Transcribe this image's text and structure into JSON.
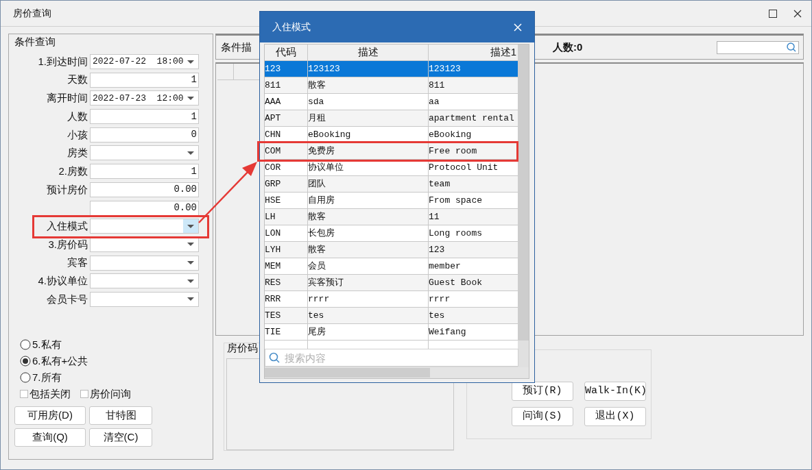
{
  "window": {
    "title": "房价查询"
  },
  "conditions": {
    "title": "条件查询",
    "fields": [
      {
        "label": "1.到达时间",
        "kind": "combo",
        "value": "2022-07-22  18:00",
        "active": false
      },
      {
        "label": "天数",
        "kind": "text",
        "value": "1"
      },
      {
        "label": "离开时间",
        "kind": "combo",
        "value": "2022-07-23  12:00",
        "active": false
      },
      {
        "label": "人数",
        "kind": "text",
        "value": "1"
      },
      {
        "label": "小孩",
        "kind": "text",
        "value": "0"
      },
      {
        "label": "房类",
        "kind": "combo",
        "active": false
      },
      {
        "label": "2.房数",
        "kind": "text",
        "value": "1"
      },
      {
        "label": "预计房价",
        "kind": "text",
        "value": "0.00"
      },
      {
        "kind": "text",
        "value": "0.00"
      },
      {
        "label": "入住模式",
        "kind": "combo",
        "active": true
      },
      {
        "label": "3.房价码",
        "kind": "combo",
        "active": false
      },
      {
        "label": "宾客",
        "kind": "combo",
        "active": false
      },
      {
        "label": "4.协议单位",
        "kind": "combo",
        "active": false
      },
      {
        "label": "会员卡号",
        "kind": "combo",
        "active": false
      }
    ],
    "radios": [
      {
        "label": "5.私有",
        "selected": false
      },
      {
        "label": "6.私有+公共",
        "selected": true
      },
      {
        "label": "7.所有",
        "selected": false
      }
    ],
    "checkboxes": [
      {
        "label": "包括关闭",
        "checked": false
      },
      {
        "label": "房价问询",
        "checked": false
      }
    ],
    "buttons": [
      "可用房(D)",
      "甘特图",
      "查询(Q)",
      "清空(C)"
    ]
  },
  "summary": {
    "title": "条件描",
    "people": "人数:0"
  },
  "rate_code_group": {
    "title": "房价码"
  },
  "actions": [
    "预订(R)",
    "Walk-In(K)",
    "问询(S)",
    "退出(X)"
  ],
  "dialog": {
    "title": "入住模式",
    "columns": [
      "代码",
      "描述",
      "描述1"
    ],
    "rows": [
      {
        "cells": [
          "123",
          "123123",
          "123123"
        ],
        "selected": true
      },
      {
        "cells": [
          "811",
          "散客",
          "811"
        ],
        "selected": false
      },
      {
        "cells": [
          "AAA",
          "sda",
          "aa"
        ],
        "selected": false
      },
      {
        "cells": [
          "APT",
          "月租",
          "apartment rental"
        ],
        "selected": false
      },
      {
        "cells": [
          "CHN",
          "eBooking",
          "eBooking"
        ],
        "selected": false
      },
      {
        "cells": [
          "COM",
          "免费房",
          "Free room"
        ],
        "selected": false
      },
      {
        "cells": [
          "COR",
          "协议单位",
          "Protocol Unit"
        ],
        "selected": false
      },
      {
        "cells": [
          "GRP",
          "团队",
          "team"
        ],
        "selected": false
      },
      {
        "cells": [
          "HSE",
          "自用房",
          "From space"
        ],
        "selected": false
      },
      {
        "cells": [
          "LH",
          "散客",
          "11"
        ],
        "selected": false
      },
      {
        "cells": [
          "LON",
          "长包房",
          "Long rooms"
        ],
        "selected": false
      },
      {
        "cells": [
          "LYH",
          "散客",
          "123"
        ],
        "selected": false
      },
      {
        "cells": [
          "MEM",
          "会员",
          "member"
        ],
        "selected": false
      },
      {
        "cells": [
          "RES",
          "宾客预订",
          "Guest Book"
        ],
        "selected": false
      },
      {
        "cells": [
          "RRR",
          "rrrr",
          "rrrr"
        ],
        "selected": false
      },
      {
        "cells": [
          "TES",
          "tes",
          "tes"
        ],
        "selected": false
      },
      {
        "cells": [
          "TIE",
          "尾房",
          "Weifang"
        ],
        "selected": false
      }
    ],
    "search": {
      "placeholder": "搜索内容"
    }
  }
}
